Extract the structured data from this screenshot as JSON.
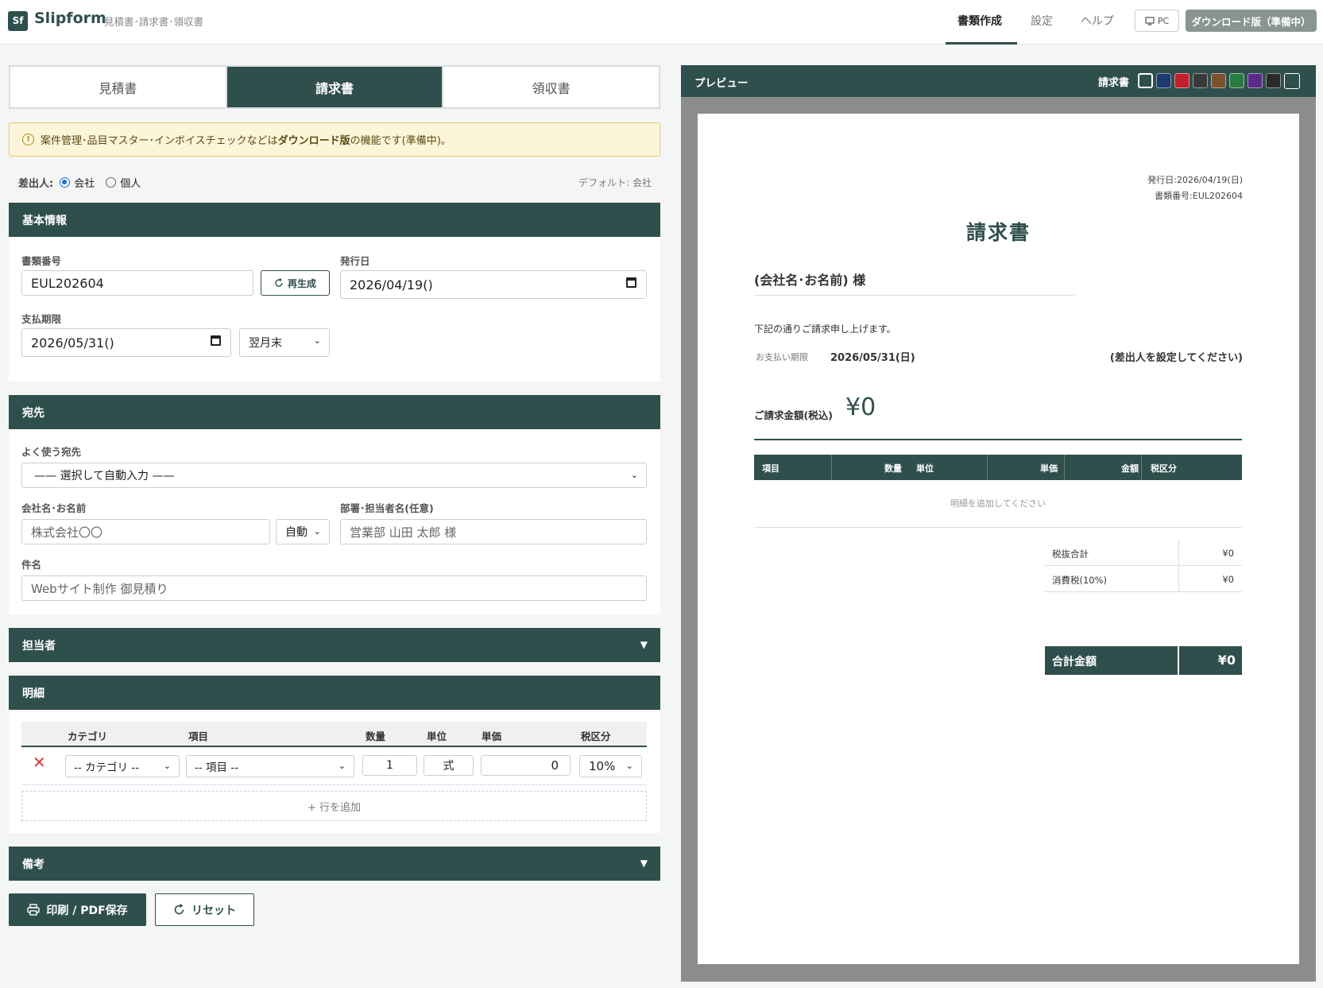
{
  "header": {
    "logo": "Sf",
    "app_name": "Slipform",
    "subtitle": "見積書･請求書･領収書",
    "nav": [
      "書類作成",
      "設定",
      "ヘルプ"
    ],
    "pc_label": "PC",
    "download_label": "ダウンロード版（準備中）"
  },
  "doc_tabs": [
    "見積書",
    "請求書",
    "領収書"
  ],
  "notice": {
    "prefix": "案件管理･品目マスター･インボイスチェックなどは",
    "bold": "ダウンロード版",
    "suffix": "の機能です(準備中)。"
  },
  "sender": {
    "label": "差出人:",
    "options": [
      "会社",
      "個人"
    ],
    "selected": "会社",
    "default_text": "デフォルト: 会社"
  },
  "basic": {
    "title": "基本情報",
    "doc_no_label": "書類番号",
    "doc_no": "EUL202604",
    "regen_label": "再生成",
    "issue_label": "発行日",
    "issue_date": "2026/04/19()",
    "due_label": "支払期限",
    "due_date": "2026/05/31()",
    "due_term": "翌月末"
  },
  "recipient": {
    "title": "宛先",
    "favorites_label": "よく使う宛先",
    "favorites_value": "—— 選択して自動入力 ——",
    "company_label": "会社名･お名前",
    "company_placeholder": "株式会社〇〇",
    "honorific": "自動",
    "dept_label": "部署･担当者名(任意)",
    "dept_placeholder": "営業部 山田 太郎 様",
    "subject_label": "件名",
    "subject_placeholder": "Webサイト制作 御見積り"
  },
  "staff": {
    "title": "担当者"
  },
  "lines": {
    "title": "明細",
    "columns": [
      "カテゴリ",
      "項目",
      "数量",
      "単位",
      "単価",
      "税区分"
    ],
    "row": {
      "category": "-- カテゴリ --",
      "item": "-- 項目 --",
      "qty": "1",
      "unit": "式",
      "price": "0",
      "tax": "10%"
    },
    "add_row": "+ 行を追加"
  },
  "remarks": {
    "title": "備考"
  },
  "actions": {
    "print": "印刷 / PDF保存",
    "reset": "リセット"
  },
  "preview": {
    "title": "プレビュー",
    "doc_type": "請求書",
    "swatches": [
      "#ffffff",
      "#1f3a6e",
      "#c0202a",
      "#3a3a3a",
      "#7a5230",
      "#2a7a44",
      "#5a2a8a",
      "#2a2a2a",
      "#2f4f4d"
    ],
    "issue_line": "発行日:2026/04/19(日)",
    "number_line": "書類番号:EUL202604",
    "doc_title": "請求書",
    "to_name": "(会社名･お名前) 様",
    "intro": "下記の通りご請求申し上げます。",
    "due_label": "お支払い期限",
    "due_value": "2026/05/31(日)",
    "sender_prompt": "(差出人を設定してください)",
    "amount_label": "ご請求金額(税込)",
    "amount_value": "¥0",
    "item_columns": [
      "項目",
      "数量",
      "単位",
      "単価",
      "金額",
      "税区分"
    ],
    "empty_items": "明細を追加してください",
    "subtotal_label": "税抜合計",
    "subtotal_value": "¥0",
    "tax_label": "消費税(10%)",
    "tax_value": "¥0",
    "total_label": "合計金額",
    "total_value": "¥0"
  }
}
